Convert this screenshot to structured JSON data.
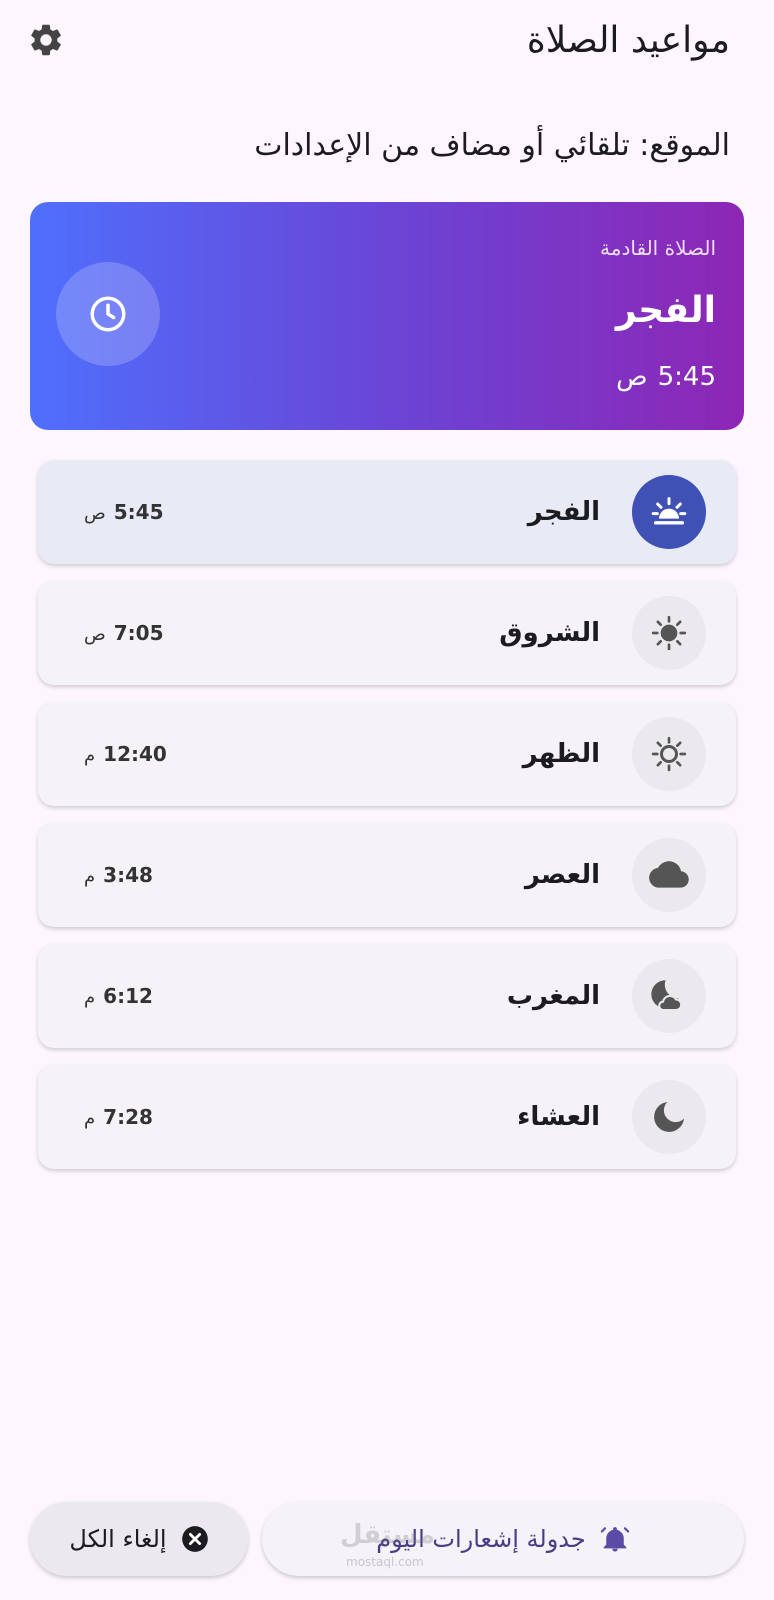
{
  "app_bar": {
    "title": "مواعيد الصلاة",
    "settings_icon": "gear-icon"
  },
  "location": {
    "text": "الموقع: تلقائي أو مضاف من الإعدادات"
  },
  "next_prayer": {
    "label": "الصلاة القادمة",
    "name": "الفجر",
    "time": "5:45",
    "period": "ص",
    "icon": "clock-icon"
  },
  "prayers": [
    {
      "name": "الفجر",
      "time": "5:45",
      "period": "ص",
      "icon": "sunrise-icon",
      "active": true
    },
    {
      "name": "الشروق",
      "time": "7:05",
      "period": "ص",
      "icon": "sun-filled-icon",
      "active": false
    },
    {
      "name": "الظهر",
      "time": "12:40",
      "period": "م",
      "icon": "sun-outline-icon",
      "active": false
    },
    {
      "name": "العصر",
      "time": "3:48",
      "period": "م",
      "icon": "cloud-icon",
      "active": false
    },
    {
      "name": "المغرب",
      "time": "6:12",
      "period": "م",
      "icon": "night-cloud-icon",
      "active": false
    },
    {
      "name": "العشاء",
      "time": "7:28",
      "period": "م",
      "icon": "moon-icon",
      "active": false
    }
  ],
  "buttons": {
    "schedule_label": "جدولة إشعارات اليوم",
    "cancel_label": "إلغاء الكل"
  },
  "watermark": {
    "text": "مستقل",
    "sub": "mostaql.com"
  },
  "colors": {
    "background": "#fdf7fd",
    "card_gradient_start": "#8e26b5",
    "card_gradient_end": "#4f6ffd",
    "active_row": "#e8ebf6",
    "active_icon": "#3f51b5",
    "schedule_text": "#4a3c86"
  }
}
